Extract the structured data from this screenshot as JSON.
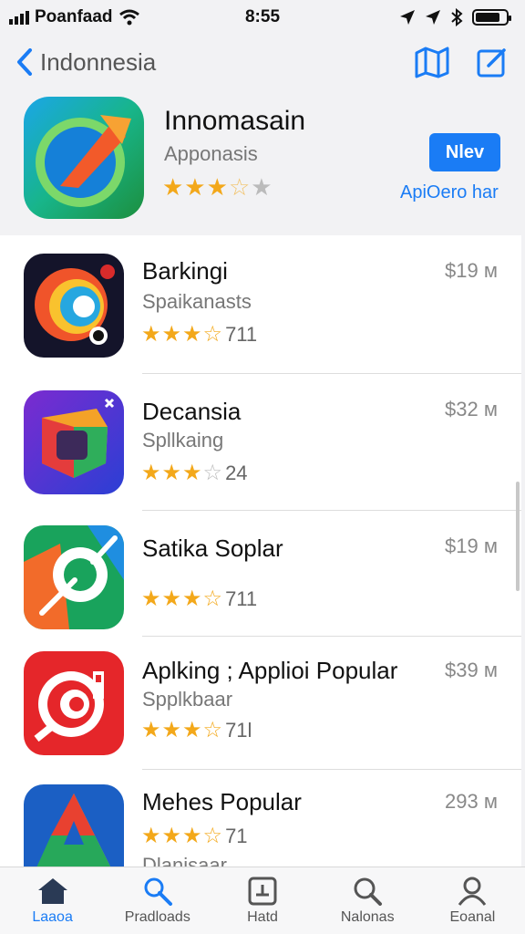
{
  "status_bar": {
    "carrier": "Poanfaad",
    "time": "8:55"
  },
  "nav": {
    "back_label": "Indonnesia"
  },
  "featured": {
    "title": "Innomasain",
    "subtitle": "Apponasis",
    "rating_stars": 3.5,
    "button_label": "Nlev",
    "link_label": "ApiOero har"
  },
  "apps": [
    {
      "name": "Barkingi",
      "subtitle": "Spaikanasts",
      "rating_stars": 3.5,
      "rating_count": "711",
      "price": "$19 м"
    },
    {
      "name": "Decansia",
      "subtitle": "Spllkaing",
      "rating_stars": 3,
      "rating_count": "24",
      "price": "$32 м"
    },
    {
      "name": "Satika Soplar",
      "subtitle": "",
      "rating_stars": 3.5,
      "rating_count": "711",
      "price": "$19 м"
    },
    {
      "name": "Aplking ; Applioi Popular",
      "subtitle": "Spplkbaar",
      "rating_stars": 3.5,
      "rating_count": "71l",
      "price": "$39 м"
    },
    {
      "name": "Mehes Popular",
      "subtitle": "Dlanisaar",
      "rating_stars": 3.5,
      "rating_count": "71",
      "price": "293 м"
    }
  ],
  "tabs": [
    {
      "label": "Laaoa",
      "icon": "house-icon",
      "active": true
    },
    {
      "label": "Pradloads",
      "icon": "search-glass-icon",
      "active": false
    },
    {
      "label": "Hatd",
      "icon": "tray-icon",
      "active": false
    },
    {
      "label": "Nalonas",
      "icon": "magnifier-icon",
      "active": false
    },
    {
      "label": "Eoanal",
      "icon": "person-icon",
      "active": false
    }
  ],
  "colors": {
    "accent": "#1a7cf5",
    "star": "#f3a81a"
  }
}
